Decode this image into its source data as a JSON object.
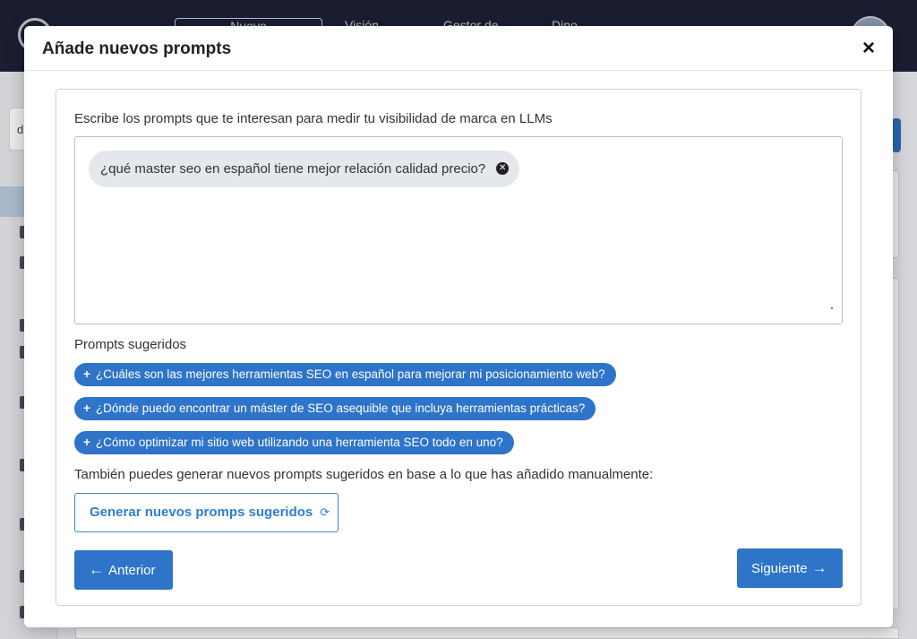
{
  "background": {
    "nav": [
      "Nuevo",
      "Visión",
      "Gestor de",
      "Dino"
    ],
    "search_value": "d"
  },
  "modal": {
    "title": "Añade nuevos prompts",
    "close_symbol": "×",
    "instruction": "Escribe los prompts que te interesan para medir tu visibilidad de marca en LLMs",
    "prompts": [
      "¿qué master seo en español tiene mejor relación calidad precio?"
    ],
    "suggested_label": "Prompts sugeridos",
    "suggestions": [
      "¿Cuáles son las mejores herramientas SEO en español para mejorar mi posicionamiento web?",
      "¿Dónde puedo encontrar un máster de SEO asequible que incluya herramientas prácticas?",
      "¿Cómo optimizar mi sitio web utilizando una herramienta SEO todo en uno?"
    ],
    "generate_hint": "También puedes generar nuevos prompts sugeridos en base a lo que has añadido manualmente:",
    "generate_button": "Generar nuevos promps sugeridos",
    "prev_button": "Anterior",
    "next_button": "Siguiente"
  },
  "icons": {
    "close": "close-icon",
    "chip_remove": "x-circle-icon",
    "add": "plus-icon",
    "refresh": "refresh-icon",
    "prev": "arrow-left-icon",
    "next": "arrow-right-icon"
  },
  "colors": {
    "primary": "#2e74c9",
    "topbar": "#1e2136",
    "chip_bg": "#e4e7ec"
  }
}
